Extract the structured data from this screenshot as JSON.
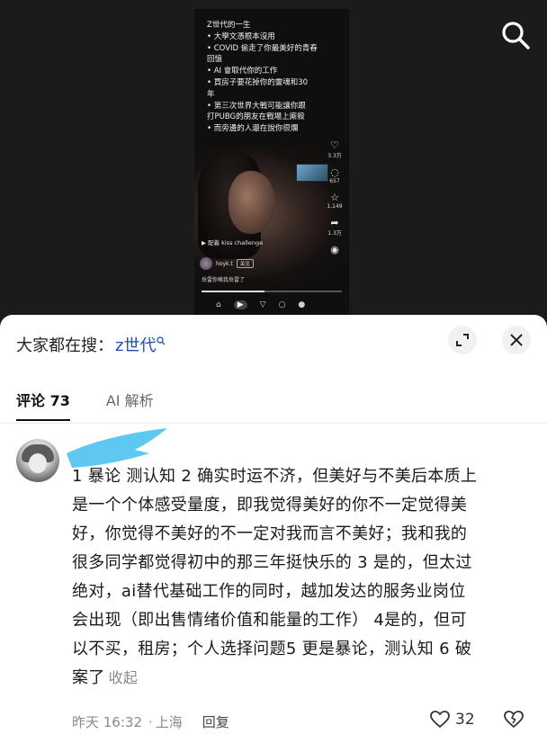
{
  "video": {
    "caption_lines": [
      "Z世代的一生",
      "• 大學文憑根本沒用",
      "• COVID 偷走了你最美好的青春",
      "回憶",
      "• AI 會取代你的工作",
      "• 買房子要花掉你的靈魂和30",
      "年",
      "• 第三次世界大戰可能讓你跟",
      "打PUBG的朋友在戰場上廝殺",
      "• 而旁邊的人還在說你很爛"
    ],
    "side_counts": [
      "3.3万",
      "657",
      "1,149",
      "1.3万"
    ],
    "music_tag": "▶ 配着   kiss challenge",
    "username": "hoyk.t",
    "follow_label": "关注",
    "description": "岳雷你格我岳雷了",
    "progress": 0.45
  },
  "search": {
    "prefix": "大家都在搜：",
    "term": "z世代",
    "icon": "search-icon"
  },
  "tabs": [
    {
      "label": "评论 73",
      "active": true
    },
    {
      "label": "AI 解析",
      "active": false
    }
  ],
  "comment": {
    "lines": [
      "1 暴论  测认知 2 确实时运不济，但美好与不美后本质上",
      "是一个个体感受量度，即我觉得美好的你不一定觉得美",
      "好，你觉得不美好的不一定对我而言不美好；我和我的",
      "很多同学都觉得初中的那三年挺快乐的 3 是的，但太过",
      "绝对，ai替代基础工作的同时，越加发达的服务业岗位",
      "会出现（即出售情绪价值和能量的工作） 4是的，但可",
      "以不买，租房；个人选择问题5 更是暴论，测认知 6 破",
      "案了"
    ],
    "collapse_label": "收起",
    "time": "昨天 16:32",
    "location": "上海",
    "reply_label": "回复",
    "likes": "32"
  },
  "colors": {
    "accent_link": "#1f4fa8",
    "redaction": "#5fc8f2",
    "sheet_bg": "#ffffff",
    "top_bg": "#1b1b1b"
  }
}
